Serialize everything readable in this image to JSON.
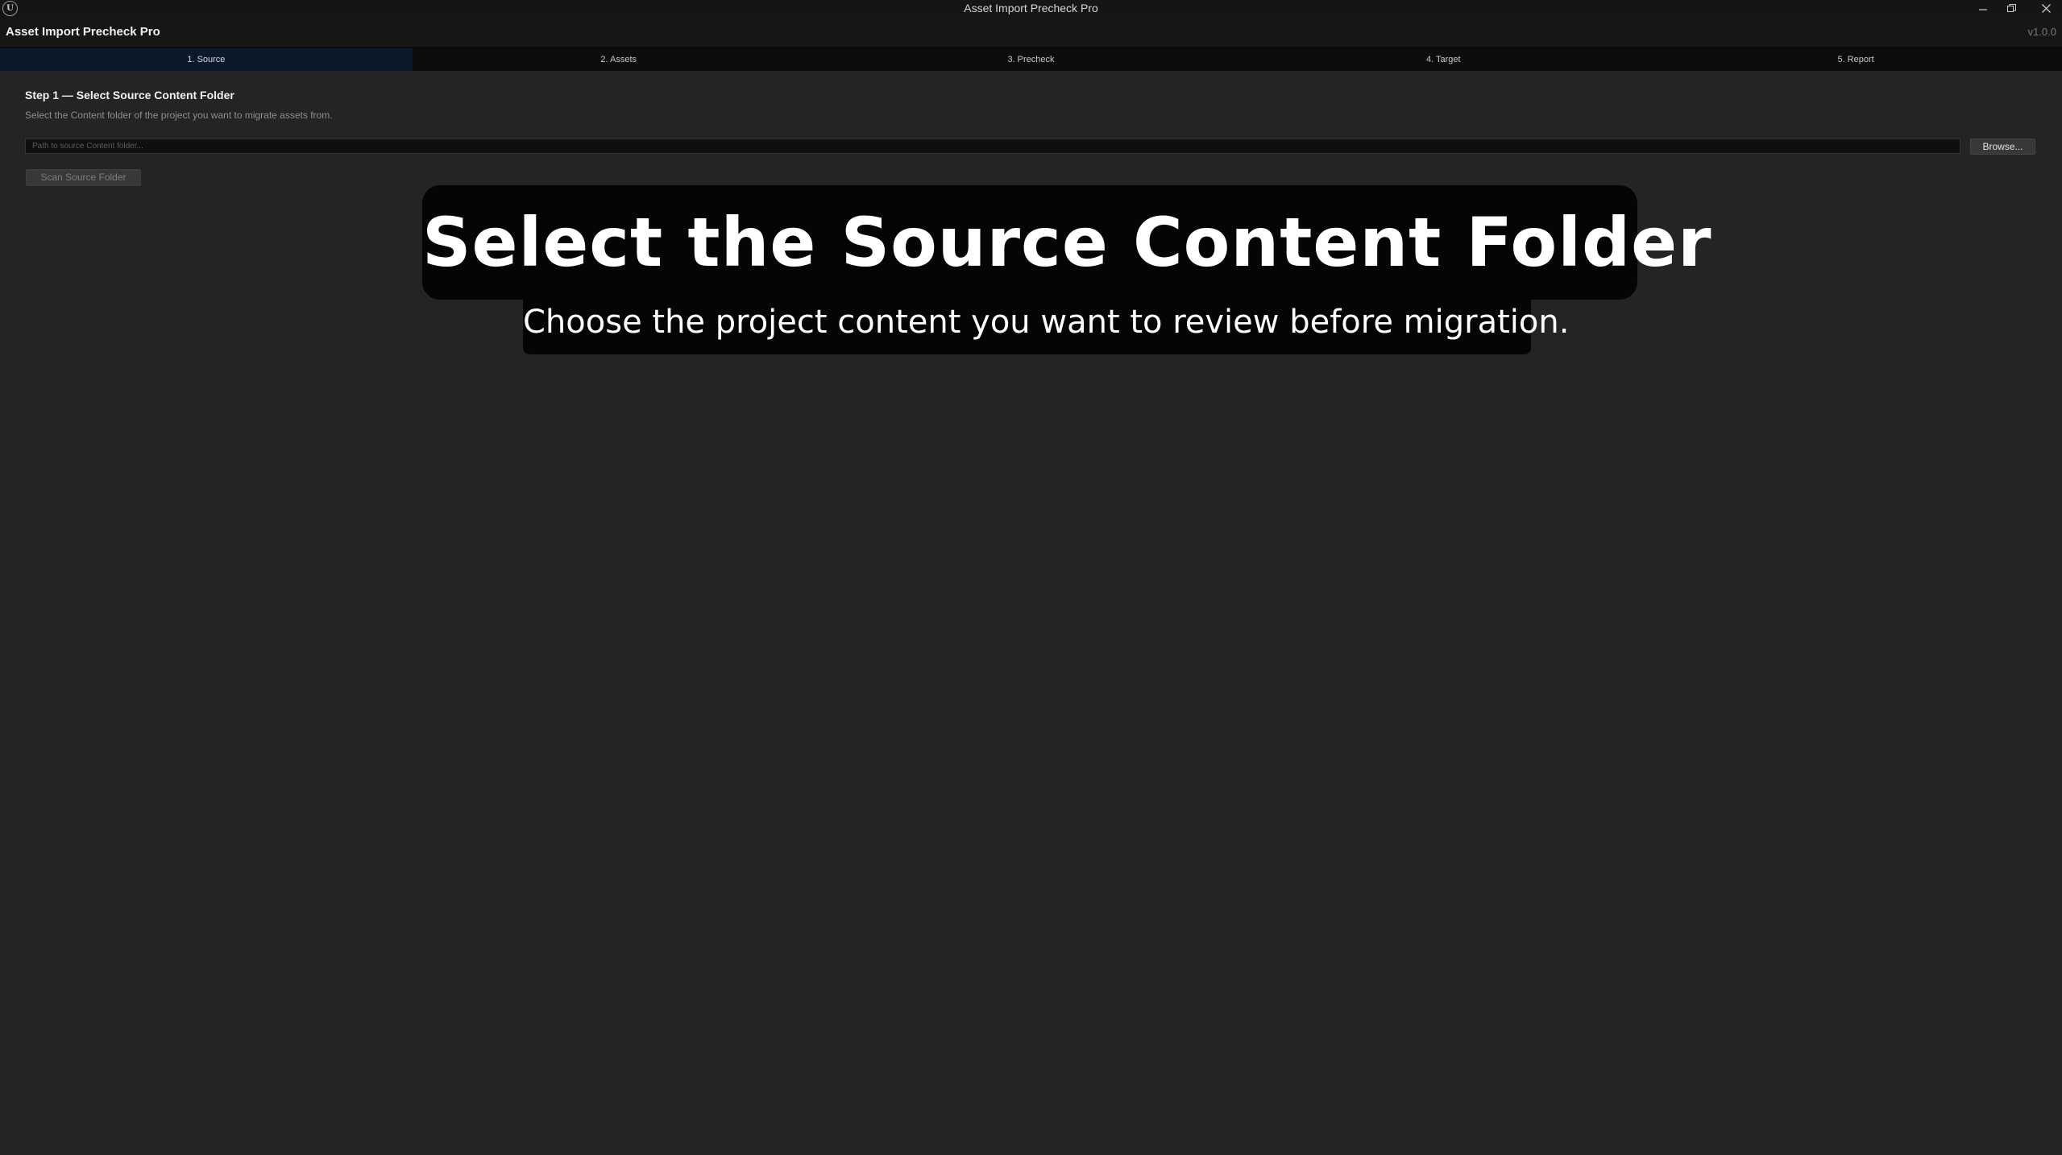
{
  "window": {
    "title": "Asset Import Precheck Pro",
    "logo_text": "U",
    "controls": {
      "minimize_icon": "minimize-icon",
      "restore_icon": "restore-icon",
      "close_icon": "close-icon"
    }
  },
  "header": {
    "title": "Asset Import Precheck Pro",
    "version": "v1.0.0"
  },
  "tabs": [
    {
      "label": "1. Source",
      "active": true
    },
    {
      "label": "2. Assets",
      "active": false
    },
    {
      "label": "3. Precheck",
      "active": false
    },
    {
      "label": "4. Target",
      "active": false
    },
    {
      "label": "5. Report",
      "active": false
    }
  ],
  "step": {
    "heading": "Step 1 — Select Source Content Folder",
    "description": "Select the Content folder of the project you want to migrate assets from."
  },
  "path_input": {
    "value": "",
    "placeholder": "Path to source Content folder..."
  },
  "buttons": {
    "browse": "Browse...",
    "scan": "Scan Source Folder"
  },
  "overlay": {
    "title": "Select the Source Content Folder",
    "subtitle": "Choose the project content you want to review before migration."
  },
  "colors": {
    "background": "#242424",
    "header": "#161616",
    "tab_active": "#0b1a2b",
    "caption_bg": "#050505"
  }
}
